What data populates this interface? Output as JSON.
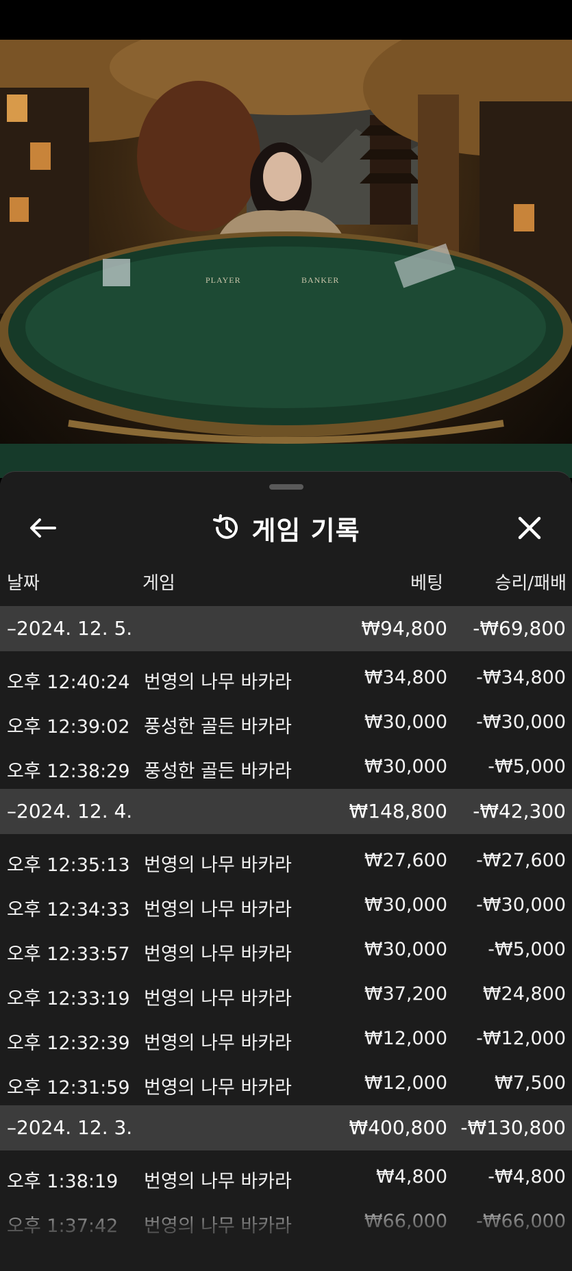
{
  "header": {
    "title": "게임 기록",
    "back_icon": "arrow-left-icon",
    "history_icon": "history-clock-icon",
    "close_icon": "close-icon"
  },
  "table": {
    "columns": {
      "date": "날짜",
      "game": "게임",
      "bet": "베팅",
      "result": "승리/패배"
    },
    "groups": [
      {
        "date": "–2024. 12. 5.",
        "bet": "₩94,800",
        "result": "-₩69,800",
        "rows": [
          {
            "time": "오후 12:40:24",
            "game": "번영의 나무 바카라",
            "bet": "₩34,800",
            "result": "-₩34,800"
          },
          {
            "time": "오후 12:39:02",
            "game": "풍성한 골든 바카라",
            "bet": "₩30,000",
            "result": "-₩30,000"
          },
          {
            "time": "오후 12:38:29",
            "game": "풍성한 골든 바카라",
            "bet": "₩30,000",
            "result": "-₩5,000"
          }
        ]
      },
      {
        "date": "–2024. 12. 4.",
        "bet": "₩148,800",
        "result": "-₩42,300",
        "rows": [
          {
            "time": "오후 12:35:13",
            "game": "번영의 나무 바카라",
            "bet": "₩27,600",
            "result": "-₩27,600"
          },
          {
            "time": "오후 12:34:33",
            "game": "번영의 나무 바카라",
            "bet": "₩30,000",
            "result": "-₩30,000"
          },
          {
            "time": "오후 12:33:57",
            "game": "번영의 나무 바카라",
            "bet": "₩30,000",
            "result": "-₩5,000"
          },
          {
            "time": "오후 12:33:19",
            "game": "번영의 나무 바카라",
            "bet": "₩37,200",
            "result": "₩24,800"
          },
          {
            "time": "오후 12:32:39",
            "game": "번영의 나무 바카라",
            "bet": "₩12,000",
            "result": "-₩12,000"
          },
          {
            "time": "오후 12:31:59",
            "game": "번영의 나무 바카라",
            "bet": "₩12,000",
            "result": "₩7,500"
          }
        ]
      },
      {
        "date": "–2024. 12. 3.",
        "bet": "₩400,800",
        "result": "-₩130,800",
        "rows": [
          {
            "time": "오후 1:38:19",
            "game": "번영의 나무 바카라",
            "bet": "₩4,800",
            "result": "-₩4,800"
          },
          {
            "time": "오후 1:37:42",
            "game": "번영의 나무 바카라",
            "bet": "₩66,000",
            "result": "-₩66,000"
          }
        ]
      }
    ]
  },
  "video": {
    "table_labels": {
      "player": "PLAYER",
      "banker": "BANKER"
    }
  }
}
